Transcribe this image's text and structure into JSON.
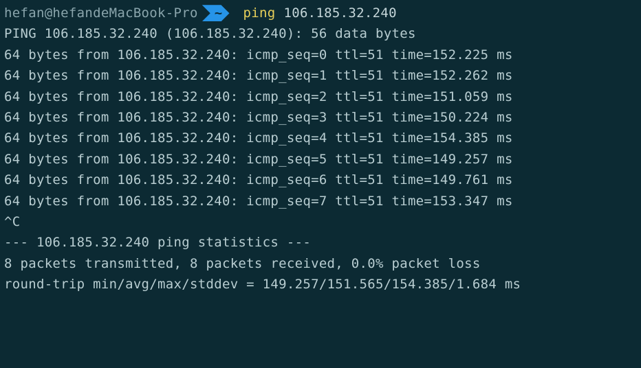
{
  "prompt": {
    "user_host": "hefan@hefandeMacBook-Pro",
    "path_indicator": "~",
    "command": "ping",
    "argument": "106.185.32.240"
  },
  "ping_header": "PING 106.185.32.240 (106.185.32.240): 56 data bytes",
  "ping_replies": [
    "64 bytes from 106.185.32.240: icmp_seq=0 ttl=51 time=152.225 ms",
    "64 bytes from 106.185.32.240: icmp_seq=1 ttl=51 time=152.262 ms",
    "64 bytes from 106.185.32.240: icmp_seq=2 ttl=51 time=151.059 ms",
    "64 bytes from 106.185.32.240: icmp_seq=3 ttl=51 time=150.224 ms",
    "64 bytes from 106.185.32.240: icmp_seq=4 ttl=51 time=154.385 ms",
    "64 bytes from 106.185.32.240: icmp_seq=5 ttl=51 time=149.257 ms",
    "64 bytes from 106.185.32.240: icmp_seq=6 ttl=51 time=149.761 ms",
    "64 bytes from 106.185.32.240: icmp_seq=7 ttl=51 time=153.347 ms"
  ],
  "interrupt": "^C",
  "stats_header": "--- 106.185.32.240 ping statistics ---",
  "stats_summary": "8 packets transmitted, 8 packets received, 0.0% packet loss",
  "stats_roundtrip": "round-trip min/avg/max/stddev = 149.257/151.565/154.385/1.684 ms"
}
